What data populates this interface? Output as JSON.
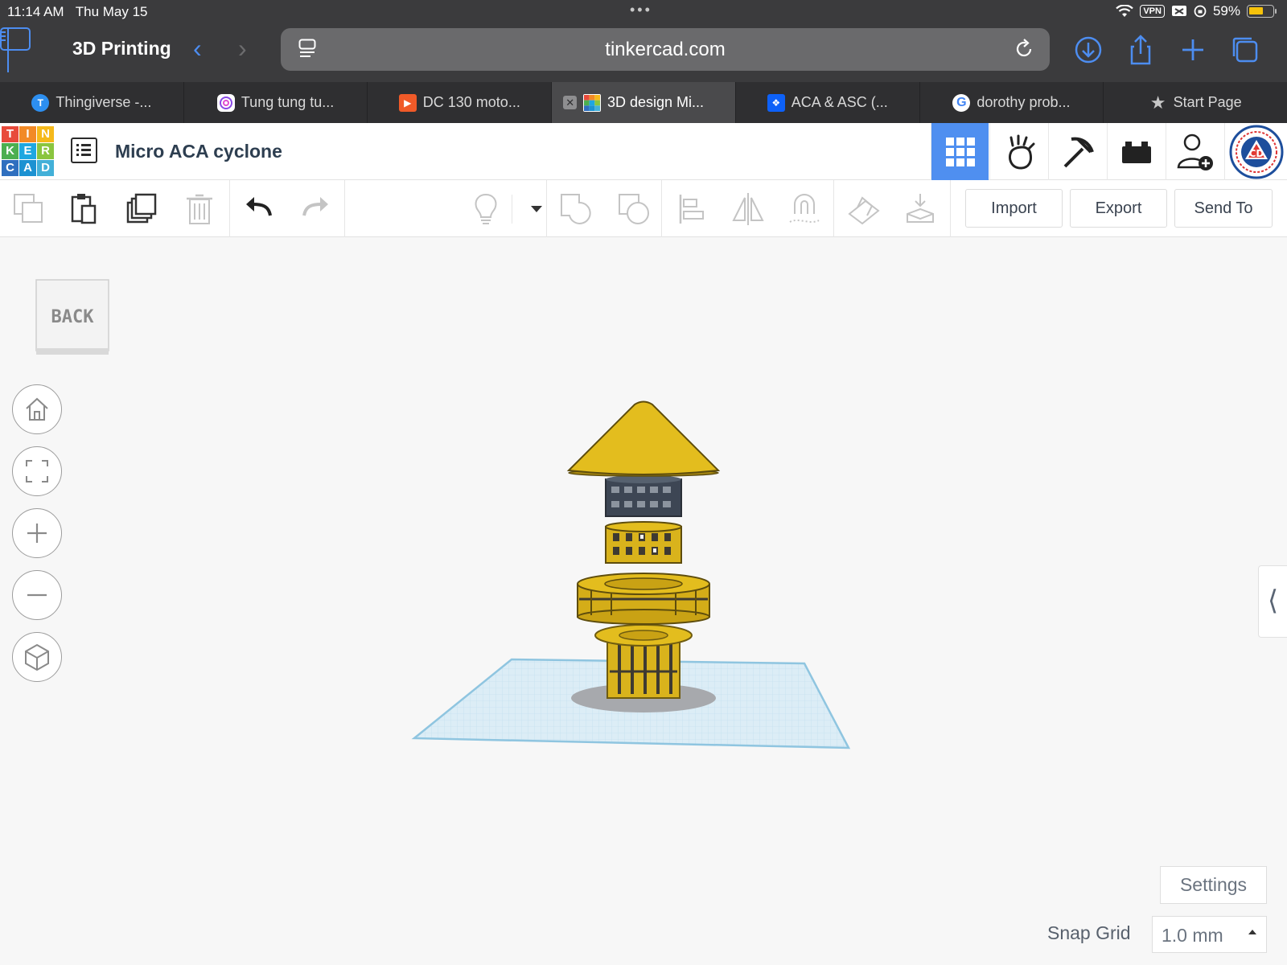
{
  "status_bar": {
    "time": "11:14 AM",
    "date": "Thu May 15",
    "multitask_indicator": "•••",
    "vpn_label": "VPN",
    "battery_percent": "59%",
    "battery_level": 0.59
  },
  "browser": {
    "tab_group_title": "3D Printing",
    "url": "tinkercad.com",
    "accent_color": "#4d8df0",
    "tabs": [
      {
        "label": "Thingiverse -...",
        "icon": "thingiverse-icon"
      },
      {
        "label": "Tung tung tu...",
        "icon": "chat-icon"
      },
      {
        "label": "DC 130 moto...",
        "icon": "play-icon"
      },
      {
        "label": "3D design Mi...",
        "icon": "tinkercad-icon",
        "active": true
      },
      {
        "label": "ACA & ASC (...",
        "icon": "dropbox-icon"
      },
      {
        "label": "dorothy prob...",
        "icon": "google-icon"
      },
      {
        "label": "Start Page",
        "icon": "star-icon"
      }
    ]
  },
  "tinkercad": {
    "logo_letters": [
      "T",
      "I",
      "N",
      "K",
      "E",
      "R",
      "C",
      "A",
      "D"
    ],
    "logo_colors": [
      "#e84a3b",
      "#f28a26",
      "#f5b91b",
      "#4caf50",
      "#1ea7e1",
      "#8ac53f",
      "#2f6fbf",
      "#1c92d2",
      "#43b0d8"
    ],
    "design_title": "Micro ACA cyclone",
    "header_buttons": [
      "grid-view-icon",
      "hand-raise-icon",
      "pickaxe-icon",
      "brick-icon",
      "add-user-icon",
      "profile-avatar"
    ],
    "toolbar": {
      "import_label": "Import",
      "export_label": "Export",
      "send_to_label": "Send To"
    },
    "viewcube_label": "BACK",
    "settings_label": "Settings",
    "snap_grid_label": "Snap Grid",
    "snap_grid_value": "1.0 mm",
    "model_color": "#e3bd1e",
    "workplane_color": "#d7ebf5"
  }
}
